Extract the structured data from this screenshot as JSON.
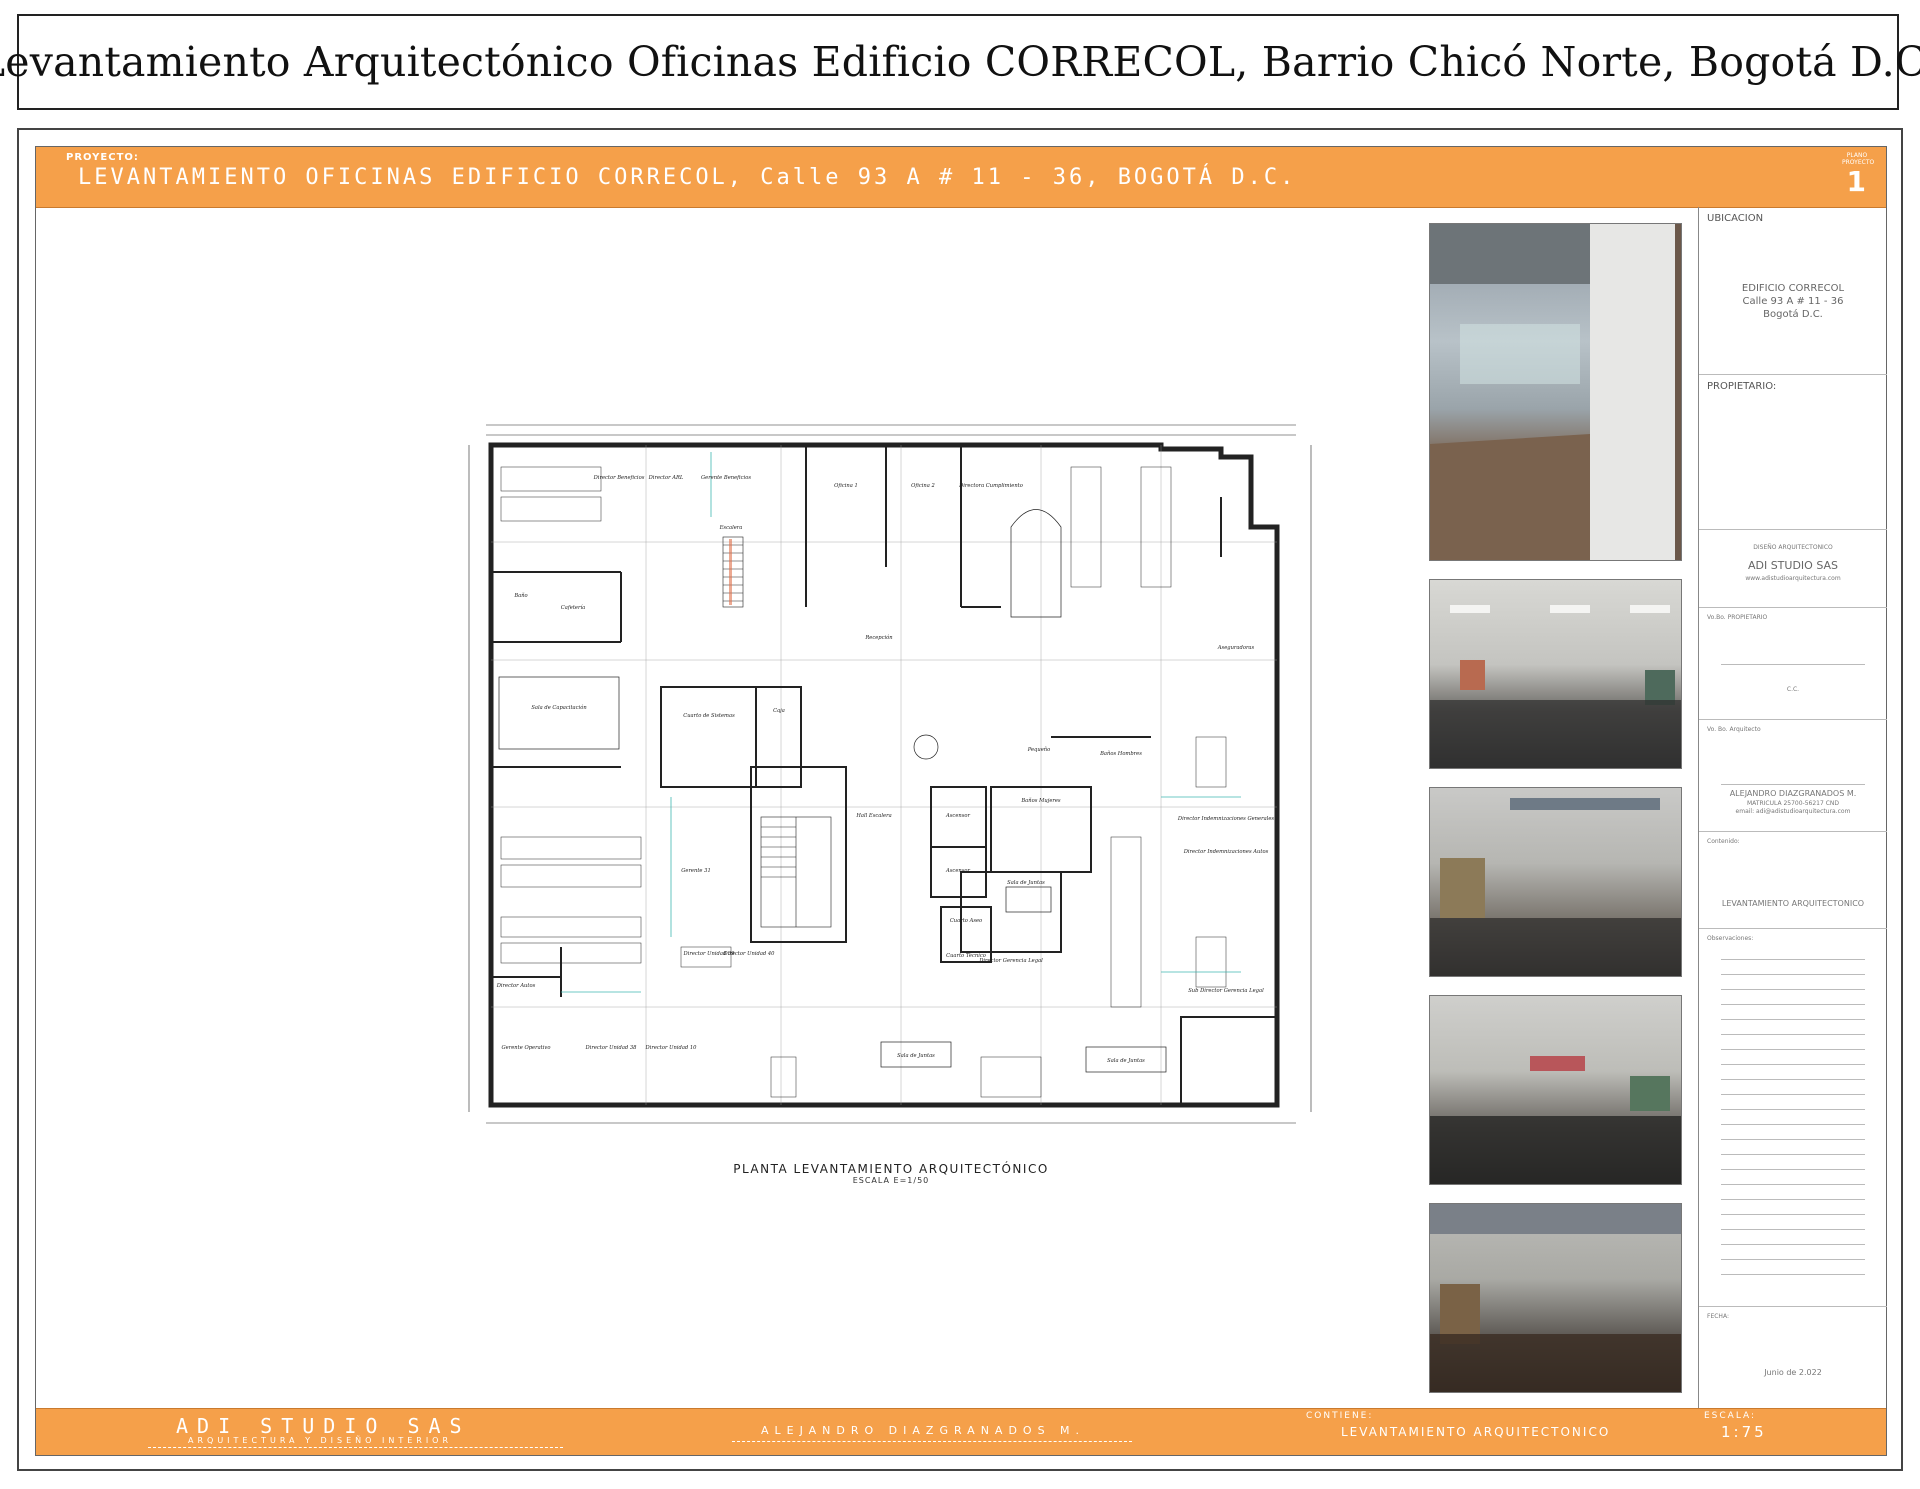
{
  "header": {
    "title": "Levantamiento Arquitectónico Oficinas Edificio CORRECOL, Barrio Chicó Norte, Bogotá D.C."
  },
  "sheet": {
    "project_label": "PROYECTO:",
    "project_title": "LEVANTAMIENTO OFICINAS EDIFICIO CORRECOL, Calle 93 A # 11 - 36, BOGOTÁ D.C.",
    "plano_label": "PLANO PROYECTO",
    "plano_number": "1",
    "accent_color": "#f5a04a"
  },
  "sidebar": {
    "ubicacion_label": "UBICACION",
    "ubicacion_lines": [
      "EDIFICIO CORRECOL",
      "Calle 93 A # 11 - 36",
      "Bogotá D.C."
    ],
    "propietario_label": "PROPIETARIO:",
    "diseno_label": "DISEÑO ARQUITECTONICO",
    "studio_name": "ADI STUDIO SAS",
    "studio_web": "www.adistudioarquitectura.com",
    "vobo_propietario_label": "Vo.Bo. PROPIETARIO",
    "cc_label": "C.C.",
    "vobo_arquitecto_label": "Vo. Bo. Arquitecto",
    "architect_name": "ALEJANDRO DIAZGRANADOS M.",
    "architect_matricula": "MATRICULA 25700-56217 CND",
    "architect_email": "email: adi@adistudioarquitectura.com",
    "contenido_label": "Contenido:",
    "contenido_value": "LEVANTAMIENTO ARQUITECTONICO",
    "observaciones_label": "Observaciones:",
    "fecha_label": "FECHA:",
    "fecha_value": "Junio de 2.022"
  },
  "plan": {
    "caption": "PLANTA LEVANTAMIENTO ARQUITECTÓNICO",
    "scale_caption": "ESCALA E=1/50",
    "rooms": {
      "director_beneficios": "Director Beneficios",
      "director_arl": "Director ARL",
      "gerente_beneficios": "Gerente Beneficios",
      "oficina1": "Oficina 1",
      "oficina2": "Oficina 2",
      "directora_cumplimiento": "Directora Cumplimiento",
      "escalera": "Escalera",
      "bano": "Baño",
      "cafeteria": "Cafetería",
      "recepcion": "Recepción",
      "sala_capacitacion": "Sala de Capacitación",
      "cuarto_sistemas": "Cuarto de Sistemas",
      "caja": "Caja",
      "hall_escalera": "Hall Escalera",
      "ascensor": "Ascensor",
      "banos_mujeres": "Baños Mujeres",
      "sala_juntas": "Sala de Juntas",
      "cuarto_aseo": "Cuarto Aseo",
      "cuarto_tecnico": "Cuarto Técnico",
      "director_gerencia_legal": "Director Gerencia Legal",
      "gerente_31": "Gerente 31",
      "director_unidad_39": "Director Unidad 39",
      "director_unidad_40": "Director Unidad 40",
      "gerente_operativo": "Gerente Operativo",
      "director_unidad_38": "Director Unidad 38",
      "director_unidad_10": "Director Unidad 10",
      "director_autos": "Director Autos",
      "aseguradoras": "Aseguradoras",
      "sub_director_gerencia_legal": "Sub Director Gerencia Legal",
      "director_indemnizaciones_generales": "Director Indemnizaciones Generales",
      "director_indemnizaciones_autos": "Director Indemnizaciones Autos",
      "banos_hombres": "Baños Hombres",
      "pequenos": "Pequeño",
      "sala_juntas_2": "Sala de Juntas",
      "sala_juntas_3": "Sala de Juntas"
    }
  },
  "photos": [
    {
      "name": "photo-glass-corridor"
    },
    {
      "name": "photo-open-office-1"
    },
    {
      "name": "photo-open-office-2"
    },
    {
      "name": "photo-open-office-3"
    },
    {
      "name": "photo-open-office-4"
    }
  ],
  "footer": {
    "studio": "ADI STUDIO SAS",
    "studio_sub": "ARQUITECTURA Y DISEÑO INTERIOR",
    "author": "ALEJANDRO DIAZGRANADOS M.",
    "contiene_label": "CONTIENE:",
    "contiene_value": "LEVANTAMIENTO ARQUITECTONICO",
    "escala_label": "ESCALA:",
    "escala_value": "1:75"
  }
}
